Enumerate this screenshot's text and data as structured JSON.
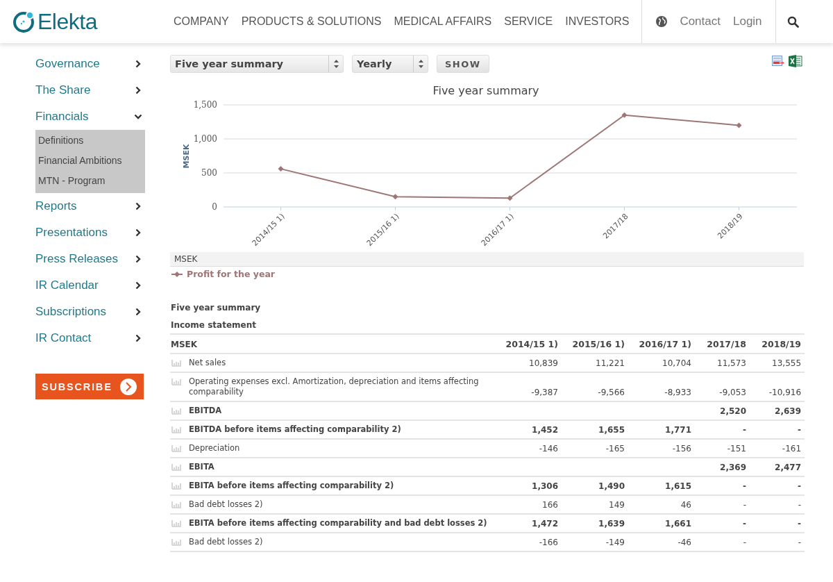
{
  "header": {
    "logo": "Elekta",
    "nav": [
      "COMPANY",
      "PRODUCTS & SOLUTIONS",
      "MEDICAL AFFAIRS",
      "SERVICE",
      "INVESTORS"
    ],
    "contact": "Contact",
    "login": "Login"
  },
  "sidebar": {
    "items": [
      {
        "label": "Governance",
        "expanded": false
      },
      {
        "label": "The Share",
        "expanded": false
      },
      {
        "label": "Financials",
        "expanded": true,
        "children": [
          "Definitions",
          "Financial Ambitions",
          "MTN - Program"
        ]
      },
      {
        "label": "Reports",
        "expanded": false
      },
      {
        "label": "Presentations",
        "expanded": false
      },
      {
        "label": "Press Releases",
        "expanded": false
      },
      {
        "label": "IR Calendar",
        "expanded": false
      },
      {
        "label": "Subscriptions",
        "expanded": false
      },
      {
        "label": "IR Contact",
        "expanded": false
      }
    ],
    "subscribe": "SUBSCRIBE"
  },
  "controls": {
    "report": "Five year summary",
    "period": "Yearly",
    "show": "SHOW"
  },
  "chart": {
    "chart_data": {
      "type": "line",
      "title": "Five year summary",
      "ylabel": "MSEK",
      "categories": [
        "2014/15 1)",
        "2015/16 1)",
        "2016/17 1)",
        "2017/18",
        "2018/19"
      ],
      "series": [
        {
          "name": "Profit for the year",
          "color": "#9e7676",
          "marker": "diamond",
          "values": [
            560,
            150,
            130,
            1350,
            1200
          ]
        }
      ],
      "ylim": [
        0,
        1500
      ],
      "yticks": [
        {
          "value": 0,
          "label": "0"
        },
        {
          "value": 500,
          "label": "500"
        },
        {
          "value": 1000,
          "label": "1,000"
        },
        {
          "value": 1500,
          "label": "1,500"
        }
      ]
    },
    "legend_header": "MSEK"
  },
  "table": {
    "title": "Five year summary",
    "section": "Income statement",
    "columns": [
      "MSEK",
      "2014/15 1)",
      "2015/16 1)",
      "2016/17 1)",
      "2017/18",
      "2018/19"
    ],
    "rows": [
      {
        "label": "Net sales",
        "bold": false,
        "values": {
          "c1": "10,839",
          "c2": "11,221",
          "c3": "10,704",
          "c4": "11,573",
          "c5": "13,555"
        }
      },
      {
        "label": "Operating expenses excl. Amortization, depreciation and items affecting comparability",
        "bold": false,
        "values": {
          "c1": "-9,387",
          "c2": "-9,566",
          "c3": "-8,933",
          "c4": "-9,053",
          "c5": "-10,916"
        }
      },
      {
        "label": "EBITDA",
        "bold": true,
        "values": {
          "c4": "2,520",
          "c5": "2,639"
        }
      },
      {
        "label": "EBITDA before items affecting comparability 2)",
        "bold": true,
        "values": {
          "c1": "1,452",
          "c2": "1,655",
          "c3": "1,771",
          "c4": "-",
          "c5": "-"
        }
      },
      {
        "label": "Depreciation",
        "bold": false,
        "values": {
          "c1": "-146",
          "c2": "-165",
          "c3": "-156",
          "c4": "-151",
          "c5": "-161"
        }
      },
      {
        "label": "EBITA",
        "bold": true,
        "values": {
          "c4": "2,369",
          "c5": "2,477"
        }
      },
      {
        "label": "EBITA before items affecting comparability 2)",
        "bold": true,
        "values": {
          "c1": "1,306",
          "c2": "1,490",
          "c3": "1,615",
          "c4": "-",
          "c5": "-"
        }
      },
      {
        "label": "Bad debt losses 2)",
        "bold": false,
        "values": {
          "c1": "166",
          "c2": "149",
          "c3": "46",
          "c4": "-",
          "c5": "-"
        }
      },
      {
        "label": "EBITA before items affecting comparability and bad debt losses 2)",
        "bold": true,
        "values": {
          "c1": "1,472",
          "c2": "1,639",
          "c3": "1,661",
          "c4": "-",
          "c5": "-"
        }
      },
      {
        "label": "Bad debt losses 2)",
        "bold": false,
        "values": {
          "c1": "-166",
          "c2": "-149",
          "c3": "-46",
          "c4": "-",
          "c5": "-"
        }
      }
    ]
  }
}
